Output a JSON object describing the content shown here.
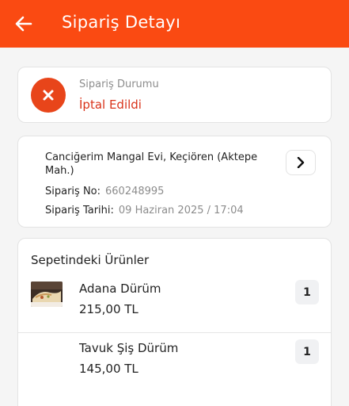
{
  "header": {
    "title": "Sipariş Detayı"
  },
  "status": {
    "label": "Sipariş Durumu",
    "value": "İptal Edildi",
    "icon": "cancel-icon",
    "color": "#e8451a"
  },
  "order": {
    "restaurant": "Canciğerim Mangal Evi, Keçiören (Aktepe Mah.)",
    "number_label": "Sipariş No:",
    "number": "660248995",
    "date_label": "Sipariş Tarihi:",
    "date": "09 Haziran 2025 / 17:04"
  },
  "basket": {
    "title": "Sepetindeki Ürünler",
    "items": [
      {
        "name": "Adana Dürüm",
        "price": "215,00 TL",
        "qty": "1",
        "has_image": true
      },
      {
        "name": "Tavuk Şiş Dürüm",
        "price": "145,00 TL",
        "qty": "1",
        "has_image": false
      }
    ]
  },
  "colors": {
    "brand": "#fa4a12",
    "status_text": "#d9331a"
  }
}
